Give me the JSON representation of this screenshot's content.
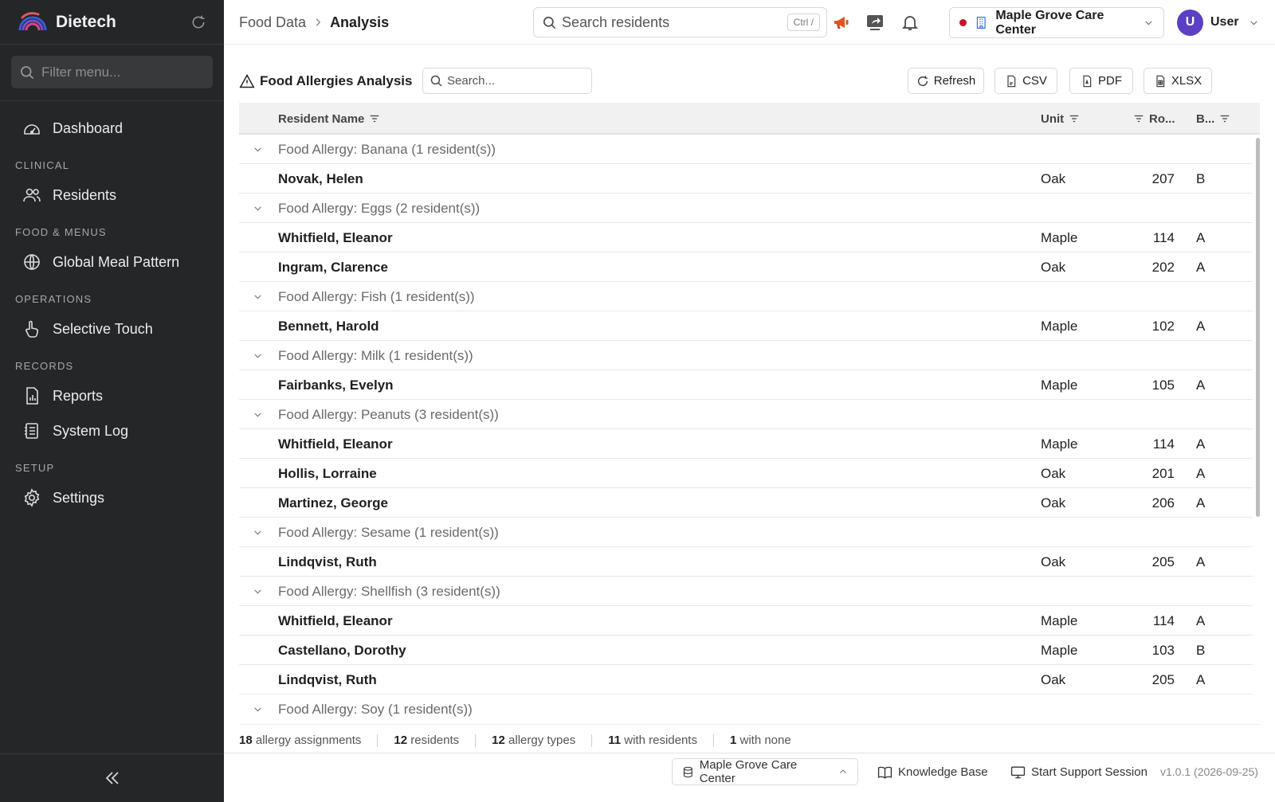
{
  "sidebar": {
    "brand": "Dietech",
    "filter_placeholder": "Filter menu...",
    "sections": {
      "clinical": "CLINICAL",
      "food_menus": "FOOD & MENUS",
      "operations": "OPERATIONS",
      "records": "RECORDS",
      "setup": "SETUP"
    },
    "items": {
      "dashboard": "Dashboard",
      "residents": "Residents",
      "global_meal_pattern": "Global Meal Pattern",
      "selective_touch": "Selective Touch",
      "reports": "Reports",
      "system_log": "System Log",
      "settings": "Settings"
    }
  },
  "header": {
    "breadcrumb": [
      "Food Data",
      "Analysis"
    ],
    "search_placeholder": "Search residents",
    "search_shortcut": "Ctrl /",
    "facility": "Maple Grove Care Center",
    "user_initial": "U",
    "user_name": "User"
  },
  "toolbar": {
    "title": "Food Allergies Analysis",
    "search_placeholder": "Search...",
    "refresh": "Refresh",
    "csv": "CSV",
    "pdf": "PDF",
    "xlsx": "XLSX"
  },
  "table": {
    "columns": {
      "name": "Resident Name",
      "unit": "Unit",
      "room": "Ro...",
      "bed": "B..."
    },
    "groups": [
      {
        "label": "Food Allergy: Banana (1 resident(s))",
        "rows": [
          {
            "name": "Novak, Helen",
            "unit": "Oak",
            "room": "207",
            "bed": "B"
          }
        ]
      },
      {
        "label": "Food Allergy: Eggs (2 resident(s))",
        "rows": [
          {
            "name": "Whitfield, Eleanor",
            "unit": "Maple",
            "room": "114",
            "bed": "A"
          },
          {
            "name": "Ingram, Clarence",
            "unit": "Oak",
            "room": "202",
            "bed": "A"
          }
        ]
      },
      {
        "label": "Food Allergy: Fish (1 resident(s))",
        "rows": [
          {
            "name": "Bennett, Harold",
            "unit": "Maple",
            "room": "102",
            "bed": "A"
          }
        ]
      },
      {
        "label": "Food Allergy: Milk (1 resident(s))",
        "rows": [
          {
            "name": "Fairbanks, Evelyn",
            "unit": "Maple",
            "room": "105",
            "bed": "A"
          }
        ]
      },
      {
        "label": "Food Allergy: Peanuts (3 resident(s))",
        "rows": [
          {
            "name": "Whitfield, Eleanor",
            "unit": "Maple",
            "room": "114",
            "bed": "A"
          },
          {
            "name": "Hollis, Lorraine",
            "unit": "Oak",
            "room": "201",
            "bed": "A"
          },
          {
            "name": "Martinez, George",
            "unit": "Oak",
            "room": "206",
            "bed": "A"
          }
        ]
      },
      {
        "label": "Food Allergy: Sesame (1 resident(s))",
        "rows": [
          {
            "name": "Lindqvist, Ruth",
            "unit": "Oak",
            "room": "205",
            "bed": "A"
          }
        ]
      },
      {
        "label": "Food Allergy: Shellfish (3 resident(s))",
        "rows": [
          {
            "name": "Whitfield, Eleanor",
            "unit": "Maple",
            "room": "114",
            "bed": "A"
          },
          {
            "name": "Castellano, Dorothy",
            "unit": "Maple",
            "room": "103",
            "bed": "B"
          },
          {
            "name": "Lindqvist, Ruth",
            "unit": "Oak",
            "room": "205",
            "bed": "A"
          }
        ]
      },
      {
        "label": "Food Allergy: Soy (1 resident(s))",
        "rows": []
      }
    ]
  },
  "summary": [
    {
      "count": "18",
      "label": "allergy assignments"
    },
    {
      "count": "12",
      "label": "residents"
    },
    {
      "count": "12",
      "label": "allergy types"
    },
    {
      "count": "11",
      "label": "with residents"
    },
    {
      "count": "1",
      "label": "with none"
    }
  ],
  "footer": {
    "facility": "Maple Grove Care Center",
    "knowledge_base": "Knowledge Base",
    "support": "Start Support Session",
    "version": "v1.0.1 (2026-09-25)"
  },
  "colors": {
    "sidebar_bg": "#252628",
    "accent_avatar": "#5b3fc4",
    "status_dot": "#c4162a",
    "building_icon": "#3a6fd8",
    "megaphone": "#e2541b"
  }
}
